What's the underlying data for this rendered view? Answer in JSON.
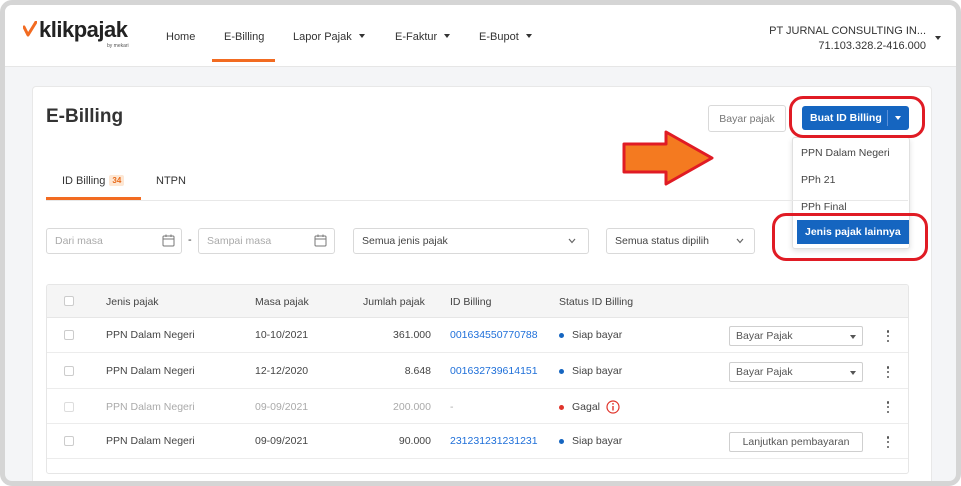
{
  "brand": {
    "name": "klikpajak",
    "sub": "by mekari",
    "accent": "#f26b21",
    "primary": "#1565c0",
    "annotation": "#e01b24",
    "arrow": "#f47a20"
  },
  "nav": {
    "items": [
      {
        "label": "Home"
      },
      {
        "label": "E-Billing",
        "active": true
      },
      {
        "label": "Lapor Pajak",
        "dropdown": true
      },
      {
        "label": "E-Faktur",
        "dropdown": true
      },
      {
        "label": "E-Bupot",
        "dropdown": true
      }
    ],
    "company": {
      "name": "PT JURNAL CONSULTING IN...",
      "npwp": "71.103.328.2-416.000"
    }
  },
  "page": {
    "title": "E-Billing",
    "bayar_label": "Bayar pajak",
    "buat_label": "Buat ID Billing",
    "dropdown": [
      "PPN Dalam Negeri",
      "PPh 21",
      "PPh Final",
      "Jenis pajak lainnya"
    ]
  },
  "tabs": [
    {
      "label": "ID Billing",
      "badge": "34",
      "active": true
    },
    {
      "label": "NTPN"
    }
  ],
  "filters": {
    "from_placeholder": "Dari masa",
    "separator": "-",
    "to_placeholder": "Sampai masa",
    "jenis": "Semua jenis pajak",
    "status": "Semua status dipilih"
  },
  "table": {
    "headers": [
      "Jenis pajak",
      "Masa pajak",
      "Jumlah pajak",
      "ID Billing",
      "Status ID Billing"
    ],
    "rows": [
      {
        "jenis": "PPN Dalam Negeri",
        "masa": "10-10/2021",
        "jumlah": "361.000",
        "id": "001634550770788",
        "status": "Siap bayar",
        "status_color": "#1565c0",
        "action": "Bayar Pajak",
        "action_type": "select"
      },
      {
        "jenis": "PPN Dalam Negeri",
        "masa": "12-12/2020",
        "jumlah": "8.648",
        "id": "001632739614151",
        "status": "Siap bayar",
        "status_color": "#1565c0",
        "action": "Bayar Pajak",
        "action_type": "select"
      },
      {
        "jenis": "PPN Dalam Negeri",
        "masa": "09-09/2021",
        "jumlah": "200.000",
        "id": "-",
        "status": "Gagal",
        "status_color": "#e0342b",
        "action": "",
        "action_type": "none",
        "info_icon": "info-icon"
      },
      {
        "jenis": "PPN Dalam Negeri",
        "masa": "09-09/2021",
        "jumlah": "90.000",
        "id": "231231231231231",
        "status": "Siap bayar",
        "status_color": "#1565c0",
        "action": "Lanjutkan pembayaran",
        "action_type": "button"
      }
    ]
  }
}
